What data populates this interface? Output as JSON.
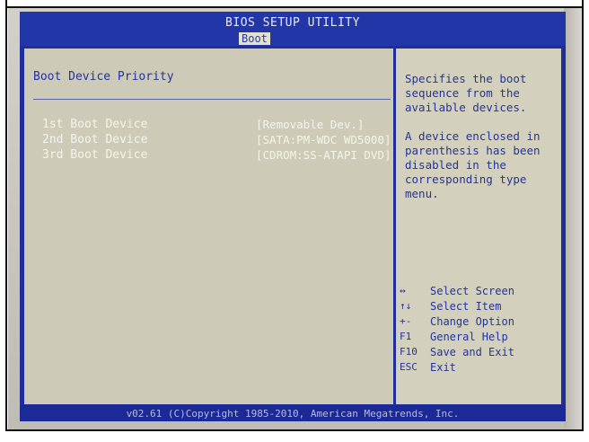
{
  "title": "BIOS SETUP UTILITY",
  "active_tab": "Boot",
  "section_title": "Boot Device Priority",
  "boot_devices": [
    {
      "label": "1st Boot Device",
      "value": "[Removable Dev.]"
    },
    {
      "label": "2nd Boot Device",
      "value": "[SATA:PM-WDC WD5000]"
    },
    {
      "label": "3rd Boot Device",
      "value": "[CDROM:SS-ATAPI DVD]"
    }
  ],
  "help": {
    "text1": "Specifies the boot sequence from the available devices.",
    "text2": "A device enclosed in parenthesis has been disabled in the corresponding type menu."
  },
  "keys": [
    {
      "key": "↔",
      "desc": "Select Screen"
    },
    {
      "key": "↑↓",
      "desc": "Select Item"
    },
    {
      "key": "+-",
      "desc": "Change Option"
    },
    {
      "key": "F1",
      "desc": "General Help"
    },
    {
      "key": "F10",
      "desc": "Save and Exit"
    },
    {
      "key": "ESC",
      "desc": "Exit"
    }
  ],
  "footer": "v02.61 (C)Copyright 1985-2010, American Megatrends, Inc.",
  "colors": {
    "screen_blue": "#1f2e9c",
    "panel_beige": "#cdcbb8",
    "highlight_text": "#f4f4ea",
    "help_text_blue": "#23339c"
  }
}
